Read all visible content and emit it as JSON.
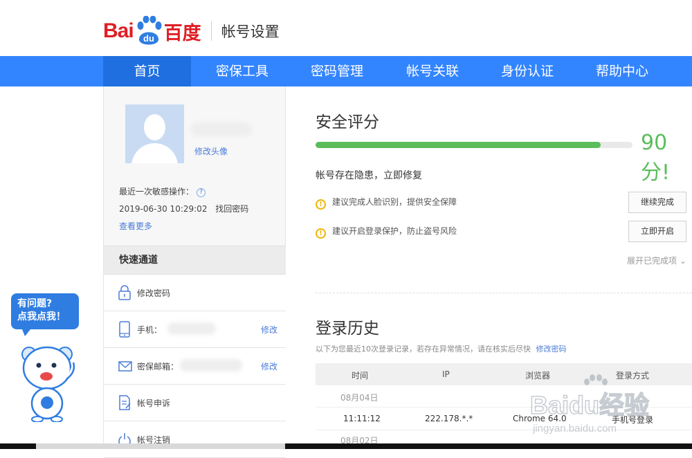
{
  "header": {
    "logo_text": "Bai",
    "logo_paw_text": "du",
    "logo_cn": "百度",
    "title": "帐号设置"
  },
  "nav": {
    "items": [
      {
        "label": "首页",
        "active": true
      },
      {
        "label": "密保工具"
      },
      {
        "label": "密码管理"
      },
      {
        "label": "帐号关联"
      },
      {
        "label": "身份认证"
      },
      {
        "label": "帮助中心"
      }
    ]
  },
  "sidebar": {
    "edit_avatar": "修改头像",
    "last_op_label": "最近一次敏感操作：",
    "help_icon": "?",
    "last_op_time": "2019-06-30 10:29:02",
    "last_op_action": "找回密码",
    "see_more": "查看更多",
    "quick_title": "快速通道",
    "quick_items": [
      {
        "label": "修改密码",
        "icon": "lock-icon",
        "edit": ""
      },
      {
        "label": "手机：",
        "icon": "phone-icon",
        "edit": "修改"
      },
      {
        "label": "密保邮箱：",
        "icon": "mail-icon",
        "edit": "修改"
      },
      {
        "label": "帐号申诉",
        "icon": "appeal-icon",
        "edit": ""
      },
      {
        "label": "帐号注销",
        "icon": "power-icon",
        "edit": ""
      }
    ]
  },
  "security": {
    "title": "安全评分",
    "score_text": "90分!",
    "score_fraction": 0.9,
    "status": "帐号存在隐患，立即修复",
    "warnings": [
      {
        "text": "建议完成人脸识别，提供安全保障",
        "button": "继续完成"
      },
      {
        "text": "建议开启登录保护，防止盗号风险",
        "button": "立即开启"
      }
    ],
    "warn_icon": "!",
    "expand_label": "展开已完成项 ⌄"
  },
  "login_history": {
    "title": "登录历史",
    "desc": "以下为您最近10次登录记录，若存在异常情况，请在核实后尽快",
    "desc_link": "修改密码",
    "columns": [
      "时间",
      "IP",
      "浏览器",
      "登录方式"
    ],
    "groups": [
      {
        "date": "08月04日",
        "rows": [
          {
            "time": "11:11:12",
            "ip": "222.178.*.*",
            "browser": "Chrome 64.0",
            "method": "手机号登录"
          }
        ]
      },
      {
        "date": "08月02日",
        "rows": []
      }
    ]
  },
  "mascot": {
    "bubble_line1": "有问题?",
    "bubble_line2": "点我点我！"
  },
  "watermark": {
    "text": "Baidu经验",
    "url": "jingyan.baidu.com"
  },
  "colors": {
    "brand_red": "#de1f26",
    "nav_blue": "#3385ff",
    "score_green": "#5bbd5b",
    "warn_yellow": "#f0b400",
    "link_blue": "#4a7bd8"
  }
}
